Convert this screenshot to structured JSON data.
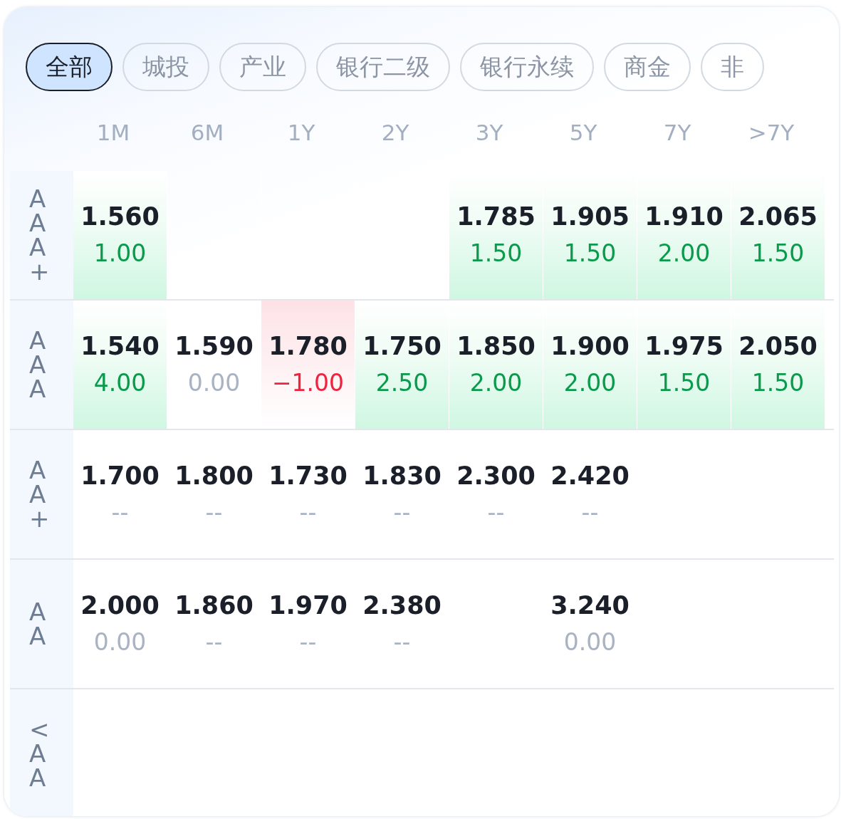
{
  "tabs": [
    {
      "label": "全部",
      "selected": true
    },
    {
      "label": "城投",
      "selected": false
    },
    {
      "label": "产业",
      "selected": false
    },
    {
      "label": "银行二级",
      "selected": false
    },
    {
      "label": "银行永续",
      "selected": false
    },
    {
      "label": "商金",
      "selected": false
    },
    {
      "label": "非",
      "selected": false
    }
  ],
  "columns": [
    "1M",
    "6M",
    "1Y",
    "2Y",
    "3Y",
    "5Y",
    "7Y",
    ">7Y"
  ],
  "rows": [
    {
      "rating": "AAA+",
      "cells": [
        {
          "kind": "up",
          "value": "1.560",
          "change": "1.00"
        },
        {
          "kind": "empty"
        },
        {
          "kind": "empty"
        },
        {
          "kind": "empty"
        },
        {
          "kind": "up",
          "value": "1.785",
          "change": "1.50"
        },
        {
          "kind": "up",
          "value": "1.905",
          "change": "1.50"
        },
        {
          "kind": "up",
          "value": "1.910",
          "change": "2.00"
        },
        {
          "kind": "up",
          "value": "2.065",
          "change": "1.50"
        }
      ]
    },
    {
      "rating": "AAA",
      "cells": [
        {
          "kind": "up",
          "value": "1.540",
          "change": "4.00"
        },
        {
          "kind": "flat",
          "value": "1.590",
          "change": "0.00"
        },
        {
          "kind": "down",
          "value": "1.780",
          "change": "−1.00"
        },
        {
          "kind": "up",
          "value": "1.750",
          "change": "2.50"
        },
        {
          "kind": "up",
          "value": "1.850",
          "change": "2.00"
        },
        {
          "kind": "up",
          "value": "1.900",
          "change": "2.00"
        },
        {
          "kind": "up",
          "value": "1.975",
          "change": "1.50"
        },
        {
          "kind": "up",
          "value": "2.050",
          "change": "1.50"
        }
      ]
    },
    {
      "rating": "AA+",
      "cells": [
        {
          "kind": "flat",
          "value": "1.700",
          "change": "--"
        },
        {
          "kind": "flat",
          "value": "1.800",
          "change": "--"
        },
        {
          "kind": "flat",
          "value": "1.730",
          "change": "--"
        },
        {
          "kind": "flat",
          "value": "1.830",
          "change": "--"
        },
        {
          "kind": "flat",
          "value": "2.300",
          "change": "--"
        },
        {
          "kind": "flat",
          "value": "2.420",
          "change": "--"
        },
        {
          "kind": "empty"
        },
        {
          "kind": "empty"
        }
      ]
    },
    {
      "rating": "AA",
      "cells": [
        {
          "kind": "flat",
          "value": "2.000",
          "change": "0.00"
        },
        {
          "kind": "flat",
          "value": "1.860",
          "change": "--"
        },
        {
          "kind": "flat",
          "value": "1.970",
          "change": "--"
        },
        {
          "kind": "flat",
          "value": "2.380",
          "change": "--"
        },
        {
          "kind": "empty"
        },
        {
          "kind": "flat",
          "value": "3.240",
          "change": "0.00"
        },
        {
          "kind": "empty"
        },
        {
          "kind": "empty"
        }
      ]
    },
    {
      "rating": "<AA",
      "cells": []
    }
  ]
}
